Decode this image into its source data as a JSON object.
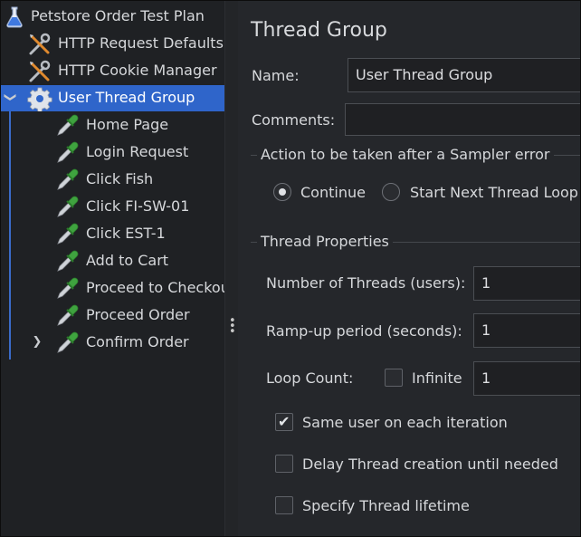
{
  "tree": {
    "items": [
      {
        "label": "Petstore Order Test Plan",
        "icon": "flask-icon"
      },
      {
        "label": "HTTP Request Defaults",
        "icon": "tools-icon"
      },
      {
        "label": "HTTP Cookie Manager",
        "icon": "tools-icon"
      },
      {
        "label": "User Thread Group",
        "icon": "gear-icon",
        "expanded_arrow": "❯"
      },
      {
        "label": "Home Page",
        "icon": "pipette-icon"
      },
      {
        "label": "Login Request",
        "icon": "pipette-icon"
      },
      {
        "label": "Click Fish",
        "icon": "pipette-icon"
      },
      {
        "label": "Click FI-SW-01",
        "icon": "pipette-icon"
      },
      {
        "label": "Click EST-1",
        "icon": "pipette-icon"
      },
      {
        "label": "Add to Cart",
        "icon": "pipette-icon"
      },
      {
        "label": "Proceed to Checkout",
        "icon": "pipette-icon"
      },
      {
        "label": "Proceed Order",
        "icon": "pipette-icon"
      },
      {
        "label": "Confirm Order",
        "icon": "pipette-icon",
        "collapsed_arrow": "❯"
      }
    ],
    "selected_color": "#2f65ca"
  },
  "panel": {
    "title": "Thread Group",
    "name_label": "Name:",
    "name_value": "User Thread Group",
    "comments_label": "Comments:",
    "comments_value": "",
    "sampler_error": {
      "title": "Action to be taken after a Sampler error",
      "options": [
        {
          "label": "Continue",
          "selected": true
        },
        {
          "label": "Start Next Thread Loop",
          "selected": false
        }
      ]
    },
    "thread_properties": {
      "title": "Thread Properties",
      "threads_label": "Number of Threads (users):",
      "threads_value": "1",
      "rampup_label": "Ramp-up period (seconds):",
      "rampup_value": "1",
      "loop_label": "Loop Count:",
      "infinite_label": "Infinite",
      "infinite_checked": false,
      "loop_value": "1",
      "same_user_label": "Same user on each iteration",
      "same_user_checked": true,
      "delay_label": "Delay Thread creation until needed",
      "delay_checked": false,
      "lifetime_label": "Specify Thread lifetime",
      "lifetime_checked": false
    }
  }
}
